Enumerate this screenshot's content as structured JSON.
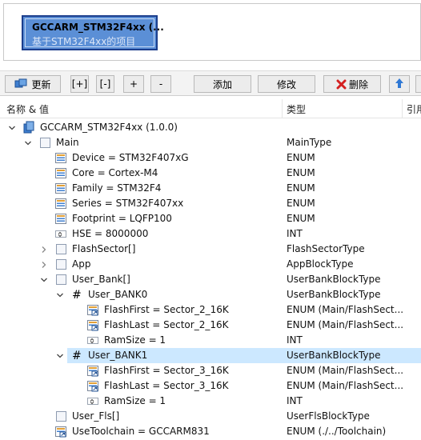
{
  "project": {
    "title": "GCCARM_STM32F4xx (...",
    "subtitle": "基于STM32F4xx的项目"
  },
  "toolbar": {
    "refresh_label": "更新",
    "expand_label": "[+]",
    "collapse_label": "[-]",
    "plus_label": "+",
    "minus_label": "-",
    "add_label": "添加",
    "modify_label": "修改",
    "delete_label": "删除"
  },
  "columns": {
    "name_value": "名称 & 值",
    "type": "类型",
    "ref": "引用"
  },
  "tree": {
    "rows": [
      {
        "name": "GCCARM_STM32F4xx (1.0.0)",
        "type": "",
        "icon": "project-icon",
        "chevron": "down",
        "indent": 0
      },
      {
        "name": "Main",
        "type": "MainType",
        "icon": "block-icon",
        "chevron": "down",
        "indent": 1
      },
      {
        "name": "Device = STM32F407xG",
        "type": "ENUM",
        "icon": "enum-icon",
        "chevron": "none",
        "indent": 2
      },
      {
        "name": "Core = Cortex-M4",
        "type": "ENUM",
        "icon": "enum-icon",
        "chevron": "none",
        "indent": 2
      },
      {
        "name": "Family = STM32F4",
        "type": "ENUM",
        "icon": "enum-icon",
        "chevron": "none",
        "indent": 2
      },
      {
        "name": "Series = STM32F407xx",
        "type": "ENUM",
        "icon": "enum-icon",
        "chevron": "none",
        "indent": 2
      },
      {
        "name": "Footprint = LQFP100",
        "type": "ENUM",
        "icon": "enum-icon",
        "chevron": "none",
        "indent": 2
      },
      {
        "name": "HSE = 8000000",
        "type": "INT",
        "icon": "int-icon",
        "chevron": "none",
        "indent": 2
      },
      {
        "name": "FlashSector[]",
        "type": "FlashSectorType",
        "icon": "block-icon",
        "chevron": "right",
        "indent": 2
      },
      {
        "name": "App",
        "type": "AppBlockType",
        "icon": "block-icon",
        "chevron": "right",
        "indent": 2
      },
      {
        "name": "User_Bank[]",
        "type": "UserBankBlockType",
        "icon": "block-icon",
        "chevron": "down",
        "indent": 2
      },
      {
        "name": "User_BANK0",
        "type": "UserBankBlockType",
        "icon": "hash-icon",
        "chevron": "down",
        "indent": 3
      },
      {
        "name": "FlashFirst = Sector_2_16K",
        "type": "ENUM (Main/FlashSect...",
        "icon": "ref-enum-icon",
        "chevron": "none",
        "indent": 4
      },
      {
        "name": "FlashLast = Sector_2_16K",
        "type": "ENUM (Main/FlashSect...",
        "icon": "ref-enum-icon",
        "chevron": "none",
        "indent": 4
      },
      {
        "name": "RamSize = 1",
        "type": "INT",
        "icon": "int-icon",
        "chevron": "none",
        "indent": 4
      },
      {
        "name": "User_BANK1",
        "type": "UserBankBlockType",
        "icon": "hash-icon",
        "chevron": "down",
        "indent": 3,
        "selected": true
      },
      {
        "name": "FlashFirst = Sector_3_16K",
        "type": "ENUM (Main/FlashSect...",
        "icon": "ref-enum-icon",
        "chevron": "none",
        "indent": 4
      },
      {
        "name": "FlashLast = Sector_3_16K",
        "type": "ENUM (Main/FlashSect...",
        "icon": "ref-enum-icon",
        "chevron": "none",
        "indent": 4
      },
      {
        "name": "RamSize = 1",
        "type": "INT",
        "icon": "int-icon",
        "chevron": "none",
        "indent": 4
      },
      {
        "name": "User_Fls[]",
        "type": "UserFlsBlockType",
        "icon": "block-icon",
        "chevron": "none",
        "indent": 2
      },
      {
        "name": "UseToolchain = GCCARM831",
        "type": "ENUM (./../Toolchain)",
        "icon": "ref-enum-icon",
        "chevron": "none",
        "indent": 2
      }
    ]
  },
  "colors": {
    "selection": "#cce8ff",
    "project_card": "#5b8fd6",
    "delete_red": "#d42020",
    "up_blue": "#2f78d4"
  }
}
